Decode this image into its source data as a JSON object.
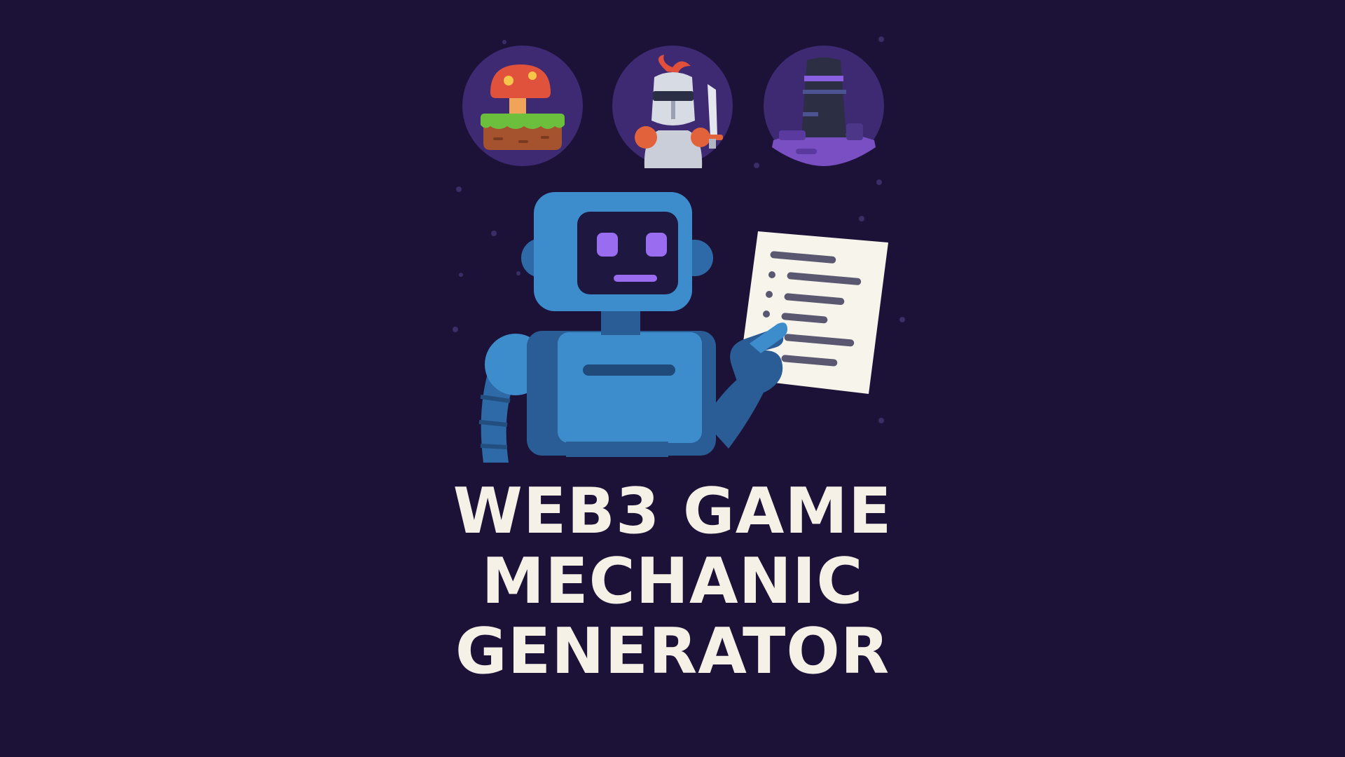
{
  "title": {
    "line1": "WEB3 GAME",
    "line2": "MECHANIC",
    "line3": "GENERATOR"
  },
  "icons": [
    {
      "name": "mushroom-platform-icon"
    },
    {
      "name": "knight-icon"
    },
    {
      "name": "tower-icon"
    }
  ],
  "colors": {
    "background": "#1c1238",
    "circle": "#3d2a73",
    "robot_blue": "#3d8dcc",
    "robot_dark": "#2a5c96",
    "visor": "#1e1740",
    "eye_purple": "#9a6cf0",
    "paper": "#f7f4ec",
    "paper_lines": "#5a5870",
    "title_text": "#f6f1e6"
  }
}
